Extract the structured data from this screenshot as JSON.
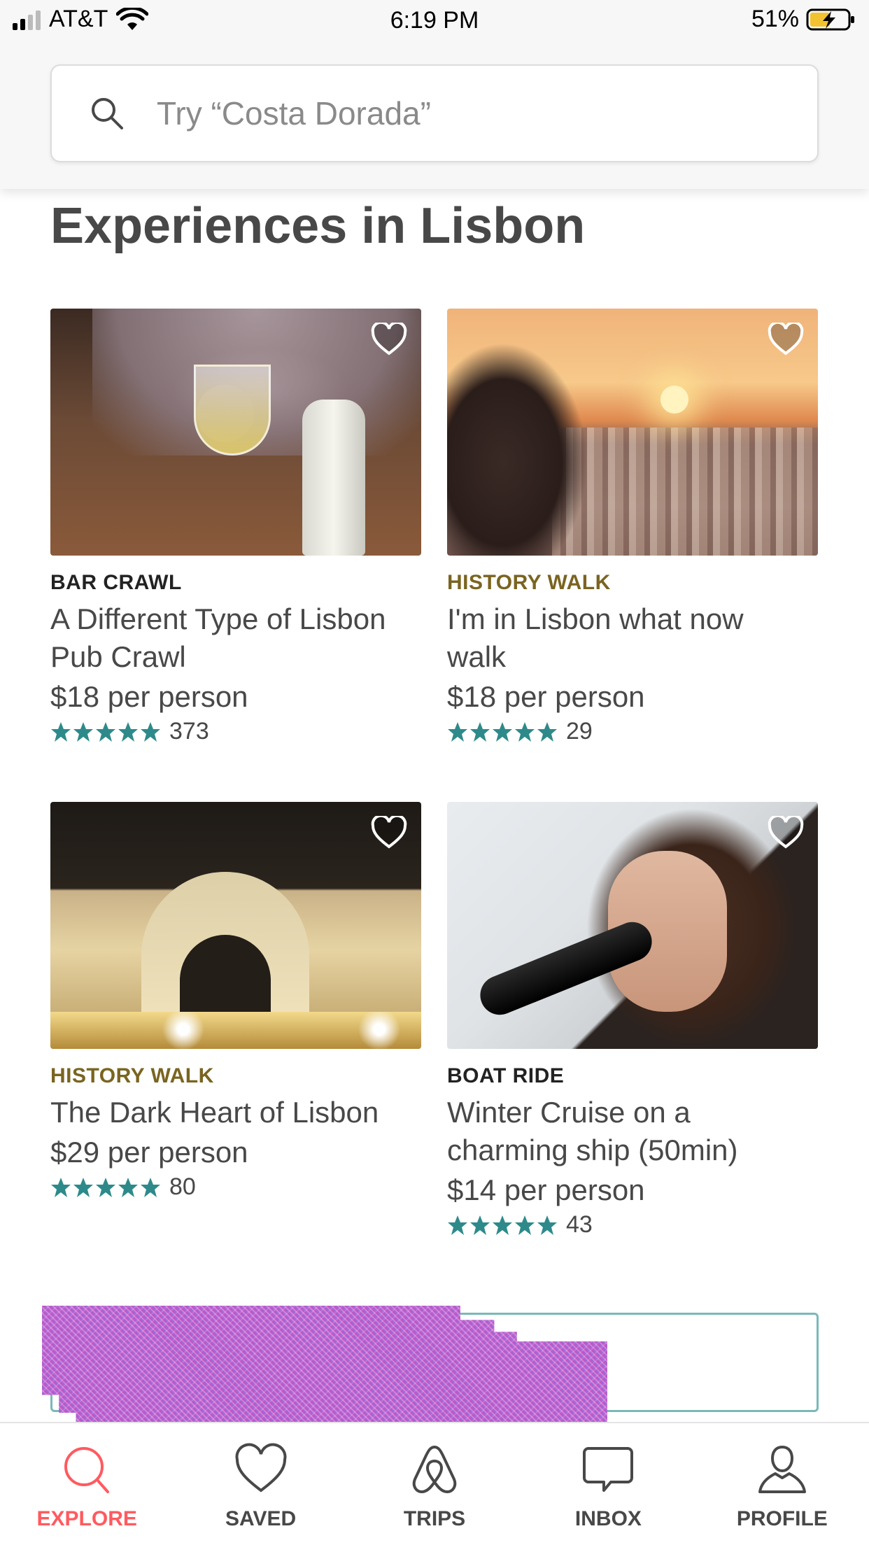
{
  "status_bar": {
    "carrier": "AT&T",
    "time": "6:19 PM",
    "battery_percent": "51%",
    "signal_bars": 2
  },
  "search": {
    "placeholder": "Try “Costa Dorada”"
  },
  "section_title": "Experiences in Lisbon",
  "colors": {
    "accent": "#ff5a5f",
    "star": "#2e8a8a",
    "category_dark": "#222222",
    "category_gold": "#7a6420"
  },
  "experiences": [
    {
      "category": "BAR CRAWL",
      "category_color": "#222222",
      "title": "A Different Type of Lisbon Pub Crawl",
      "price": "$18 per person",
      "rating_stars": 5,
      "reviews": "373",
      "saved": false
    },
    {
      "category": "HISTORY WALK",
      "category_color": "#7a6420",
      "title": "I'm in Lisbon what now walk",
      "price": "$18 per person",
      "rating_stars": 5,
      "reviews": "29",
      "saved": false
    },
    {
      "category": "HISTORY WALK",
      "category_color": "#7a6420",
      "title": "The Dark Heart of Lisbon",
      "price": "$29 per person",
      "rating_stars": 5,
      "reviews": "80",
      "saved": false
    },
    {
      "category": "BOAT RIDE",
      "category_color": "#222222",
      "title": "Winter Cruise on a charming ship (50min)",
      "price": "$14 per person",
      "rating_stars": 5,
      "reviews": "43",
      "saved": false
    }
  ],
  "tabs": [
    {
      "label": "EXPLORE",
      "icon": "search-icon",
      "active": true
    },
    {
      "label": "SAVED",
      "icon": "heart-icon",
      "active": false
    },
    {
      "label": "TRIPS",
      "icon": "airbnb-logo-icon",
      "active": false
    },
    {
      "label": "INBOX",
      "icon": "chat-bubble-icon",
      "active": false
    },
    {
      "label": "PROFILE",
      "icon": "person-icon",
      "active": false
    }
  ]
}
